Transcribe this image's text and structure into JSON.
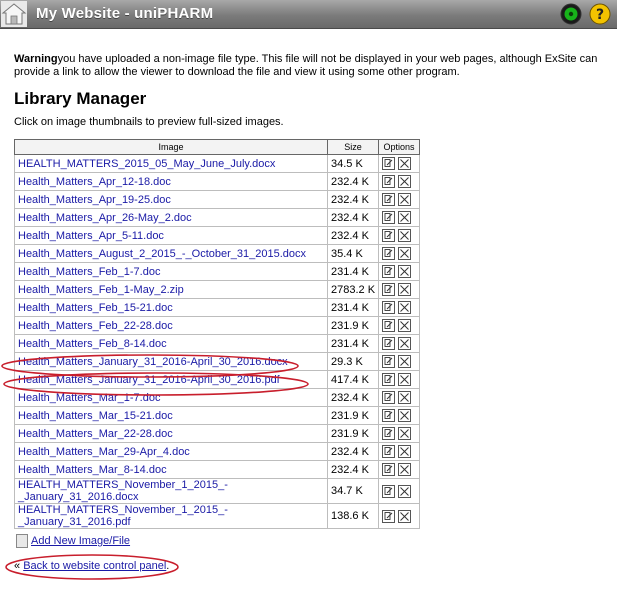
{
  "header": {
    "title": "My Website - uniPHARM",
    "icons": [
      "home-icon",
      "exsite-icon",
      "help-icon"
    ]
  },
  "warning": {
    "strong": "Warning",
    "text": "you have uploaded a non-image file type. This file will not be displayed in your web pages, although ExSite can provide a link to allow the viewer to download the file and view it using some other program."
  },
  "main": {
    "title": "Library Manager",
    "intro": "Click on image thumbnails to preview full-sized images."
  },
  "table": {
    "headers": {
      "image": "Image",
      "size": "Size",
      "options": "Options"
    },
    "rows": [
      {
        "name": "HEALTH_MATTERS_2015_05_May_June_July.docx",
        "size": "34.5 K"
      },
      {
        "name": "Health_Matters_Apr_12-18.doc",
        "size": "232.4 K"
      },
      {
        "name": "Health_Matters_Apr_19-25.doc",
        "size": "232.4 K"
      },
      {
        "name": "Health_Matters_Apr_26-May_2.doc",
        "size": "232.4 K"
      },
      {
        "name": "Health_Matters_Apr_5-11.doc",
        "size": "232.4 K"
      },
      {
        "name": "Health_Matters_August_2_2015_-_October_31_2015.docx",
        "size": "35.4 K"
      },
      {
        "name": "Health_Matters_Feb_1-7.doc",
        "size": "231.4 K"
      },
      {
        "name": "Health_Matters_Feb_1-May_2.zip",
        "size": "2783.2 K"
      },
      {
        "name": "Health_Matters_Feb_15-21.doc",
        "size": "231.4 K"
      },
      {
        "name": "Health_Matters_Feb_22-28.doc",
        "size": "231.9 K"
      },
      {
        "name": "Health_Matters_Feb_8-14.doc",
        "size": "231.4 K"
      },
      {
        "name": "Health_Matters_January_31_2016-April_30_2016.docx",
        "size": "29.3 K"
      },
      {
        "name": "Health_Matters_January_31_2016-April_30_2016.pdf",
        "size": "417.4 K"
      },
      {
        "name": "Health_Matters_Mar_1-7.doc",
        "size": "232.4 K"
      },
      {
        "name": "Health_Matters_Mar_15-21.doc",
        "size": "231.9 K"
      },
      {
        "name": "Health_Matters_Mar_22-28.doc",
        "size": "231.9 K"
      },
      {
        "name": "Health_Matters_Mar_29-Apr_4.doc",
        "size": "232.4 K"
      },
      {
        "name": "Health_Matters_Mar_8-14.doc",
        "size": "232.4 K"
      },
      {
        "name": "HEALTH_MATTERS_November_1_2015_-_January_31_2016.docx",
        "size": "34.7 K"
      },
      {
        "name": "HEALTH_MATTERS_November_1_2015_-_January_31_2016.pdf",
        "size": "138.6 K"
      }
    ],
    "row_icons": [
      "edit-icon",
      "delete-icon"
    ]
  },
  "actions": {
    "add_label": "Add New Image/File",
    "back_prefix": "«",
    "back_label": "Back to website control panel",
    "back_suffix": "."
  },
  "colors": {
    "link": "#1a1aa6",
    "annotation": "#c81e2c"
  }
}
